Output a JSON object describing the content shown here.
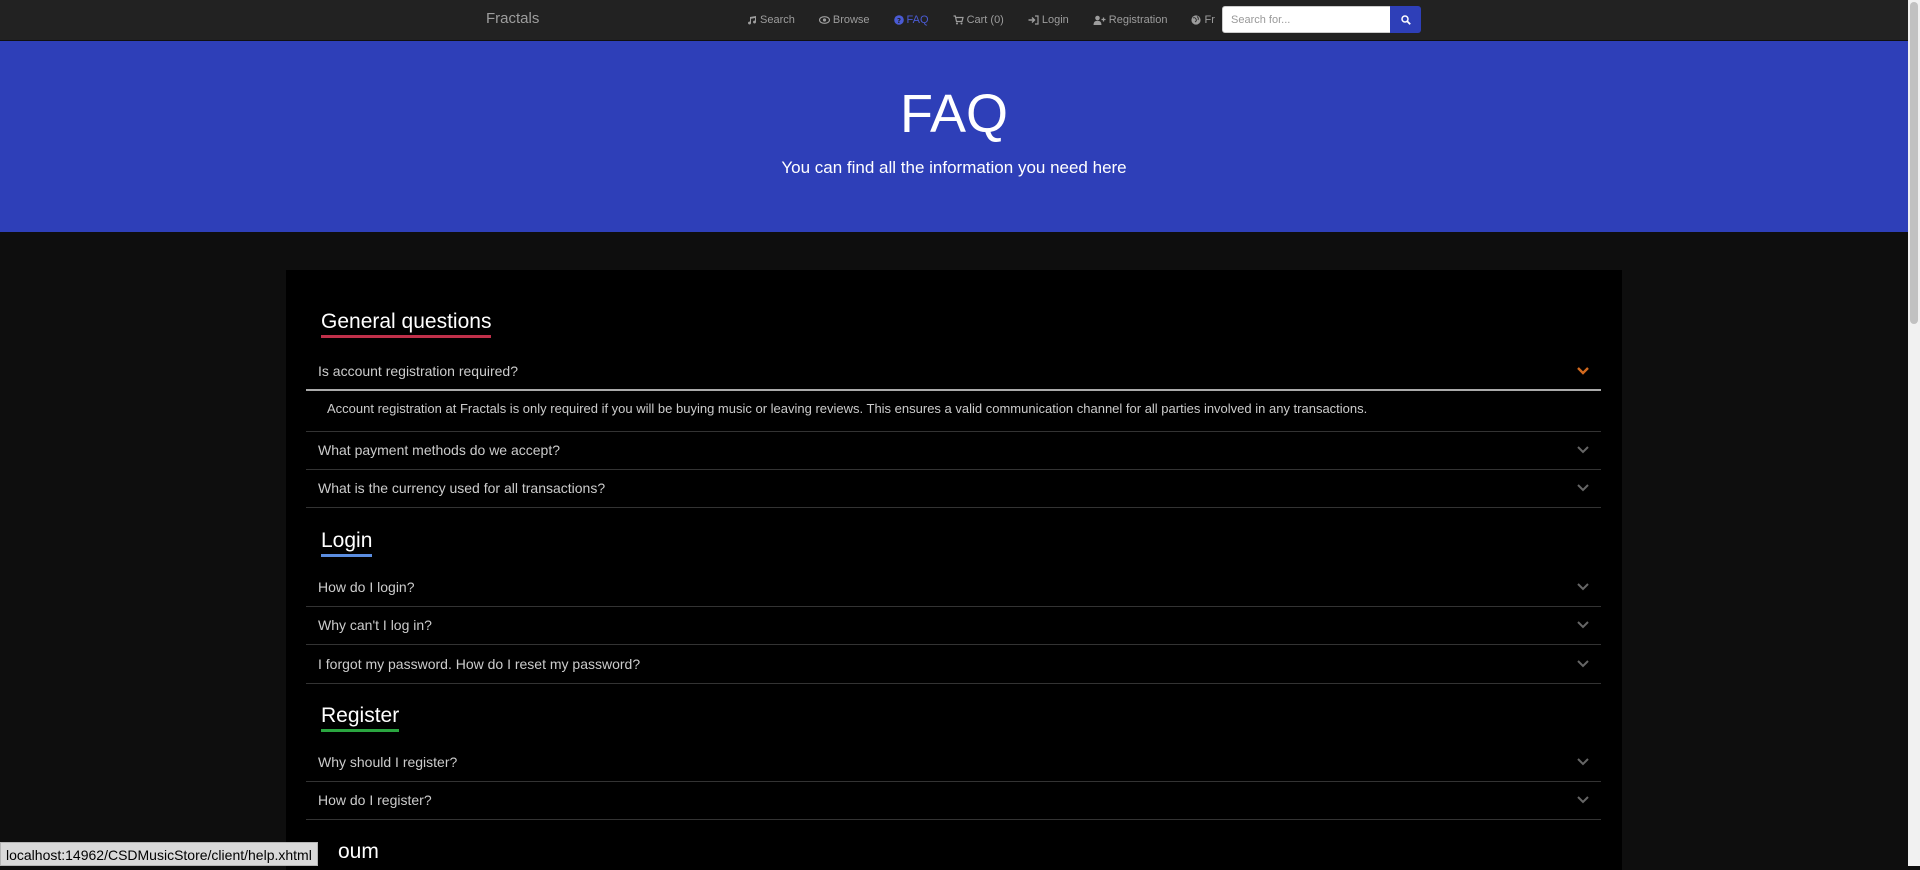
{
  "navbar": {
    "brand": "Fractals",
    "items": [
      {
        "label": "Search",
        "icon": "music-icon"
      },
      {
        "label": "Browse",
        "icon": "eye-icon"
      },
      {
        "label": "FAQ",
        "icon": "question-circle-icon"
      },
      {
        "label": "Cart (0)",
        "icon": "cart-icon"
      },
      {
        "label": "Login",
        "icon": "sign-in-icon"
      },
      {
        "label": "Registration",
        "icon": "user-plus-icon"
      },
      {
        "label": "Fr",
        "icon": "globe-icon"
      }
    ],
    "search_placeholder": "Search for..."
  },
  "hero": {
    "title": "FAQ",
    "subtitle": "You can find all the information you need here"
  },
  "sections": [
    {
      "title": "General questions",
      "questions": [
        "Is account registration required?",
        "What payment methods do we accept?",
        "What is the currency used for all transactions?"
      ],
      "open_answer": "Account registration at Fractals is only required if you will be buying music or leaving reviews. This ensures a valid communication channel for all parties involved in any transactions."
    },
    {
      "title": "Login",
      "questions": [
        "How do I login?",
        "Why can't I log in?",
        "I forgot my password. How do I reset my password?"
      ]
    },
    {
      "title": "Register",
      "questions": [
        "Why should I register?",
        "How do I register?"
      ]
    },
    {
      "title_partial": "oum"
    }
  ],
  "status_url": "localhost:14962/CSDMusicStore/client/help.xhtml",
  "colors": {
    "hero": "#2e3fb8",
    "active_nav": "#4a5bd4",
    "general_underline": "#c0304a",
    "login_underline": "#5b8de0",
    "register_underline": "#2aa640",
    "open_chevron": "#d2691e"
  }
}
